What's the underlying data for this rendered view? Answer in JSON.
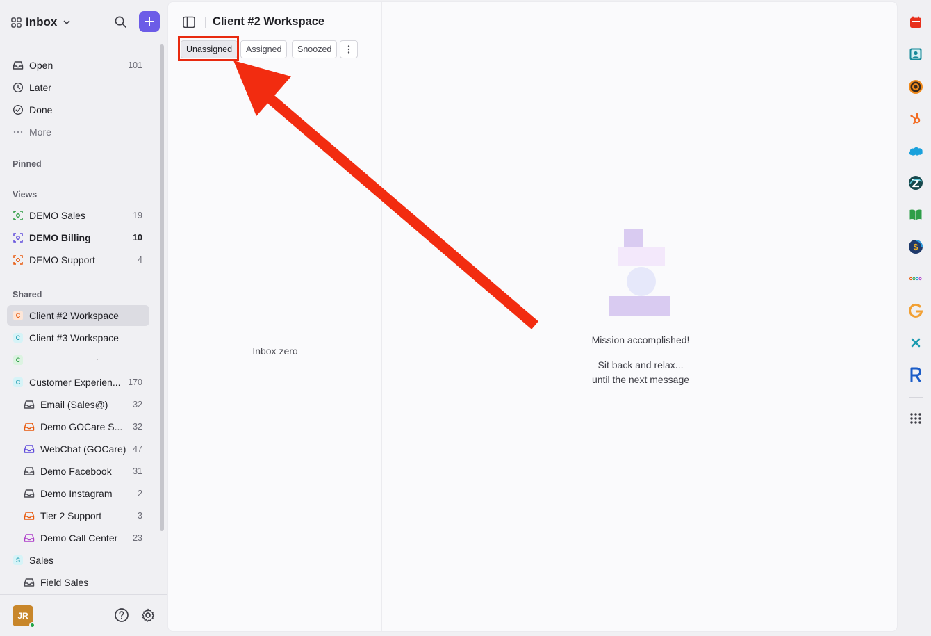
{
  "sidebar": {
    "title": "Inbox",
    "main_items": [
      {
        "label": "Open",
        "count": "101"
      },
      {
        "label": "Later",
        "count": ""
      },
      {
        "label": "Done",
        "count": ""
      },
      {
        "label": "More",
        "count": ""
      }
    ],
    "pinned_label": "Pinned",
    "views_label": "Views",
    "views": [
      {
        "label": "DEMO Sales",
        "count": "19",
        "color": "#2f9e44"
      },
      {
        "label": "DEMO Billing",
        "count": "10",
        "color": "#5f4bdb"
      },
      {
        "label": "DEMO Support",
        "count": "4",
        "color": "#e8590c"
      }
    ],
    "shared_label": "Shared",
    "shared": [
      {
        "badge": "C",
        "label": "Client #2 Workspace",
        "count": "",
        "badge_color": "#e8590c",
        "badge_bg": "#fde6d8"
      },
      {
        "badge": "C",
        "label": "Client #3 Workspace",
        "count": "",
        "badge_color": "#1c9bb0",
        "badge_bg": "#d6f3f7"
      },
      {
        "badge": "C",
        "label": ".",
        "count": "",
        "badge_color": "#2f9e44",
        "badge_bg": "#dcf3e1"
      },
      {
        "badge": "C",
        "label": "Customer Experien...",
        "count": "170",
        "badge_color": "#1c9bb0",
        "badge_bg": "#d6f3f7"
      }
    ],
    "shared_sub": [
      {
        "label": "Email (Sales@)",
        "count": "32",
        "color": "#4a4a52"
      },
      {
        "label": "Demo GOCare S...",
        "count": "32",
        "color": "#e8590c"
      },
      {
        "label": "WebChat (GOCare)",
        "count": "47",
        "color": "#5f4bdb"
      },
      {
        "label": "Demo Facebook",
        "count": "31",
        "color": "#4a4a52"
      },
      {
        "label": "Demo Instagram",
        "count": "2",
        "color": "#4a4a52"
      },
      {
        "label": "Tier 2 Support",
        "count": "3",
        "color": "#e8590c"
      },
      {
        "label": "Demo Call Center",
        "count": "23",
        "color": "#ae3ec9"
      }
    ],
    "sales": {
      "badge": "S",
      "label": "Sales",
      "badge_color": "#1c9bb0",
      "badge_bg": "#d6f3f7"
    },
    "field_sales": {
      "label": "Field Sales"
    },
    "user_initials": "JR"
  },
  "workspace": {
    "title": "Client #2 Workspace",
    "tabs": [
      "Unassigned",
      "Assigned",
      "Snoozed"
    ],
    "selected_tab": "Unassigned",
    "list_empty": "Inbox zero"
  },
  "detail": {
    "empty_title": "Mission accomplished!",
    "empty_line1": "Sit back and relax...",
    "empty_line2": "until the next message"
  },
  "rail_apps": [
    "calendar-icon",
    "contacts-icon",
    "target-app-icon",
    "hubspot-icon",
    "salesforce-icon",
    "zendesk-icon",
    "book-icon",
    "dollar-app-icon",
    "dots-app-icon",
    "google-icon",
    "x-app-icon",
    "r-app-icon",
    "app-grid-icon"
  ],
  "colors": {
    "accent": "#6c5ce7",
    "highlight": "#e82a10"
  }
}
